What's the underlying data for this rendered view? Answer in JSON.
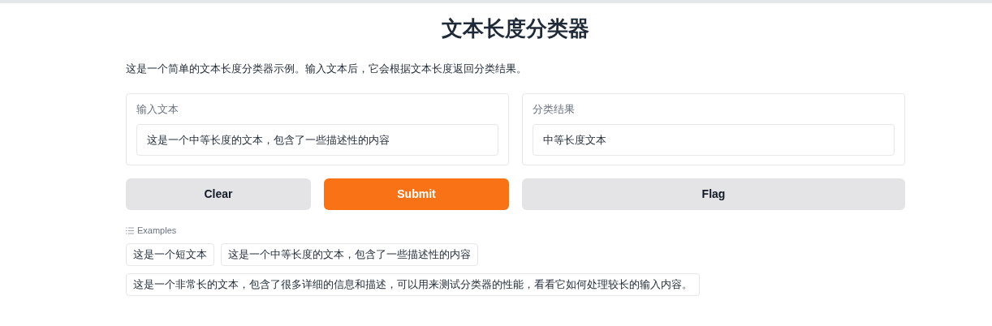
{
  "title": "文本长度分类器",
  "description": "这是一个简单的文本长度分类器示例。输入文本后，它会根据文本长度返回分类结果。",
  "input": {
    "label": "输入文本",
    "value": "这是一个中等长度的文本，包含了一些描述性的内容"
  },
  "output": {
    "label": "分类结果",
    "value": "中等长度文本"
  },
  "buttons": [
    {
      "label": "Clear",
      "kind": "secondary"
    },
    {
      "label": "Submit",
      "kind": "primary"
    },
    {
      "label": "Flag",
      "kind": "secondary"
    }
  ],
  "examples": {
    "label": "Examples",
    "items": [
      "这是一个短文本",
      "这是一个中等长度的文本，包含了一些描述性的内容",
      "这是一个非常长的文本，包含了很多详细的信息和描述，可以用来测试分类器的性能，看看它如何处理较长的输入内容。"
    ]
  }
}
